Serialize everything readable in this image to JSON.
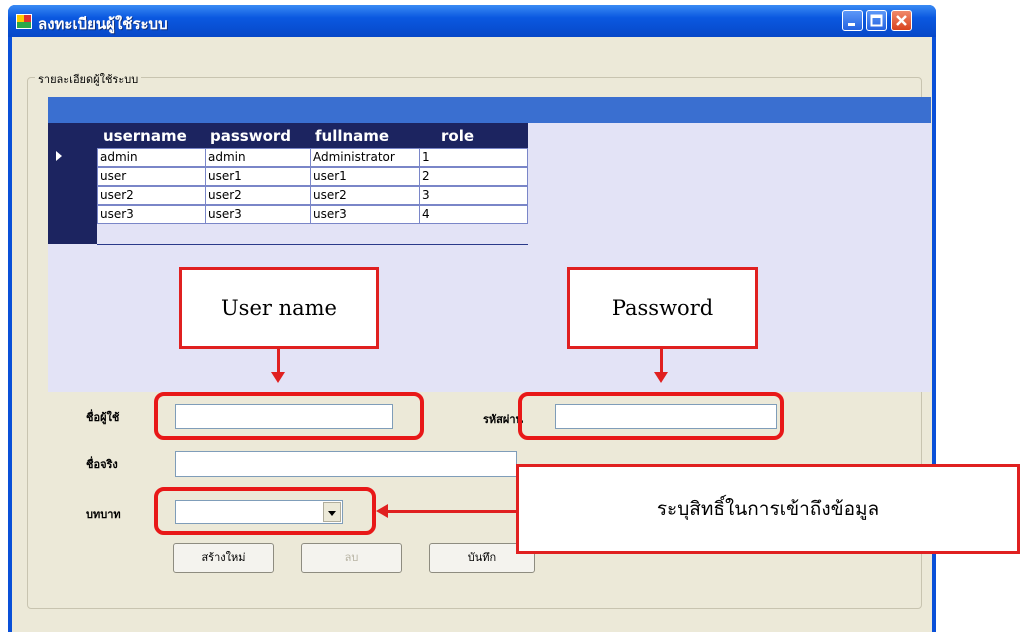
{
  "window": {
    "title": "ลงทะเบียนผู้ใช้ระบบ"
  },
  "group": {
    "title": "รายละเอียดผู้ใช้ระบบ"
  },
  "grid": {
    "columns": [
      "username",
      "password",
      "fullname",
      "role"
    ],
    "rows": [
      [
        "admin",
        "admin",
        "Administrator",
        "1"
      ],
      [
        "user",
        "user1",
        "user1",
        "2"
      ],
      [
        "user2",
        "user2",
        "user2",
        "3"
      ],
      [
        "user3",
        "user3",
        "user3",
        "4"
      ]
    ]
  },
  "form": {
    "username_label": "ชื่อผู้ใช้",
    "username_value": "",
    "password_label": "รหัสผ่าน",
    "password_value": "",
    "fullname_label": "ชื่อจริง",
    "fullname_value": "",
    "role_label": "บทบาท",
    "role_value": ""
  },
  "buttons": {
    "new_label": "สร้างใหม่",
    "delete_label": "ลบ",
    "save_label": "บันทึก"
  },
  "callouts": {
    "username": "User name",
    "password": "Password",
    "role": "ระบุสิทธิ์ในการเข้าถึงข้อมูล"
  },
  "colors": {
    "titlebar": "#0a58e0",
    "grid_header": "#1c2460",
    "callout_red": "#e02020"
  }
}
